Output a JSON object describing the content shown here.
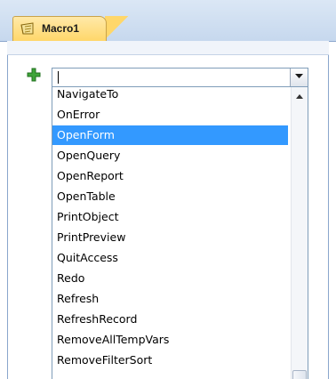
{
  "tab": {
    "label": "Macro1",
    "icon": "macro-icon"
  },
  "action_row": {
    "add_icon": "plus-icon",
    "combo_value": "",
    "dropdown_icon": "chevron-down-icon"
  },
  "dropdown": {
    "items": [
      "NavigateTo",
      "OnError",
      "OpenForm",
      "OpenQuery",
      "OpenReport",
      "OpenTable",
      "PrintObject",
      "PrintPreview",
      "QuitAccess",
      "Redo",
      "Refresh",
      "RefreshRecord",
      "RemoveAllTempVars",
      "RemoveFilterSort"
    ],
    "selected": "OpenForm"
  },
  "colors": {
    "selection": "#3399ff",
    "tab": "#ffd76a",
    "plus": "#3fa53a"
  }
}
